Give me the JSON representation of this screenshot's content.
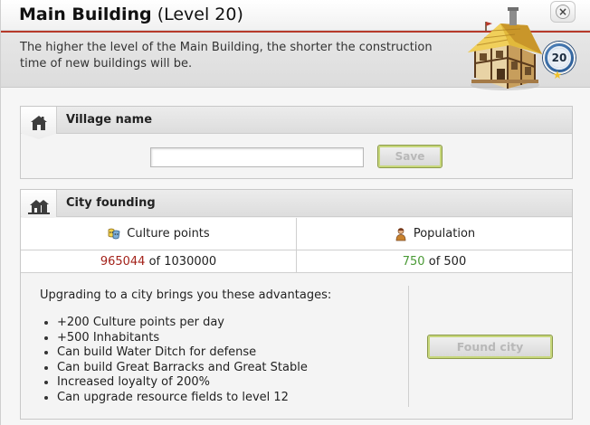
{
  "window": {
    "title_main": "Main Building",
    "title_level": "(Level 20)",
    "close_label": "×"
  },
  "description": "The higher the level of the Main Building, the shorter the construction time of new buildings will be.",
  "level_badge": "20",
  "village": {
    "heading": "Village name",
    "input_value": "",
    "save_label": "Save"
  },
  "city": {
    "heading": "City founding",
    "culture": {
      "label": "Culture points",
      "current": "965044",
      "sep": "of",
      "required": "1030000"
    },
    "population": {
      "label": "Population",
      "current": "750",
      "sep": "of",
      "required": "500"
    },
    "advantages_intro": "Upgrading to a city brings you these advantages:",
    "advantages": [
      "+200 Culture points per day",
      "+500 Inhabitants",
      "Can build Water Ditch for defense",
      "Can build Great Barracks and Great Stable",
      "Increased loyalty of 200%",
      "Can upgrade resource fields to level 12"
    ],
    "found_label": "Found city"
  },
  "colors": {
    "accent_red": "#b73a2b",
    "value_red": "#a3221a",
    "value_green": "#4a9a36",
    "button_border": "#c7d77b"
  },
  "icons": [
    "close-icon",
    "main-building-image",
    "house-icon",
    "city-house-icon",
    "culture-points-icon",
    "population-icon",
    "star-icon"
  ]
}
